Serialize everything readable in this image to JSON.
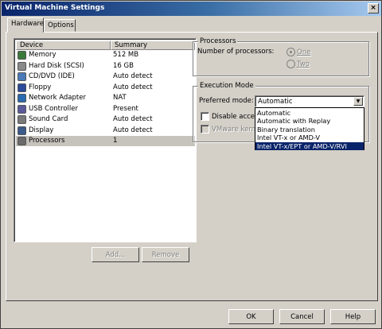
{
  "window": {
    "title": "Virtual Machine Settings",
    "close_glyph": "×"
  },
  "tabs": [
    {
      "label": "Hardware",
      "active": true
    },
    {
      "label": "Options",
      "active": false
    }
  ],
  "device_list": {
    "columns": [
      "Device",
      "Summary"
    ],
    "rows": [
      {
        "device": "Memory",
        "summary": "512 MB",
        "icon": "memory-icon",
        "icon_color": "#3a7a3a"
      },
      {
        "device": "Hard Disk (SCSI)",
        "summary": "16 GB",
        "icon": "hard-disk-icon",
        "icon_color": "#8a8a8a"
      },
      {
        "device": "CD/DVD (IDE)",
        "summary": "Auto detect",
        "icon": "cd-dvd-icon",
        "icon_color": "#4a7ab8"
      },
      {
        "device": "Floppy",
        "summary": "Auto detect",
        "icon": "floppy-icon",
        "icon_color": "#2a4a9a"
      },
      {
        "device": "Network Adapter",
        "summary": "NAT",
        "icon": "network-adapter-icon",
        "icon_color": "#2a6ab0"
      },
      {
        "device": "USB Controller",
        "summary": "Present",
        "icon": "usb-icon",
        "icon_color": "#5a5a9a"
      },
      {
        "device": "Sound Card",
        "summary": "Auto detect",
        "icon": "sound-card-icon",
        "icon_color": "#7a7a7a"
      },
      {
        "device": "Display",
        "summary": "Auto detect",
        "icon": "display-icon",
        "icon_color": "#3a5a8a"
      },
      {
        "device": "Processors",
        "summary": "1",
        "icon": "processor-icon",
        "icon_color": "#6a6a6a",
        "selected": true
      }
    ]
  },
  "list_buttons": {
    "add": "Add...",
    "remove": "Remove"
  },
  "processors_group": {
    "title": "Processors",
    "count_label": "Number of processors:",
    "options": [
      {
        "label": "One",
        "checked": true
      },
      {
        "label": "Two",
        "checked": false
      }
    ]
  },
  "execution_group": {
    "title": "Execution Mode",
    "preferred_label": "Preferred mode:",
    "selected_value": "Automatic",
    "options": [
      "Automatic",
      "Automatic with Replay",
      "Binary translation",
      "Intel VT-x or AMD-V",
      "Intel VT-x/EPT or AMD-V/RVI"
    ],
    "highlighted_index": 4,
    "checkboxes": [
      {
        "label": "Disable acceler",
        "enabled": true
      },
      {
        "label": "VMware kerne",
        "enabled": false
      }
    ]
  },
  "footer_buttons": {
    "ok": "OK",
    "cancel": "Cancel",
    "help": "Help"
  }
}
